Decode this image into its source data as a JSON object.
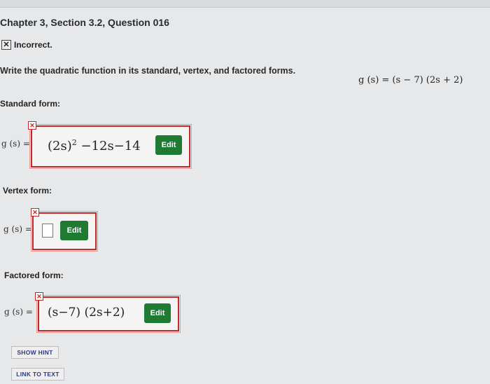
{
  "header": {
    "title": "Chapter 3, Section 3.2, Question 016"
  },
  "status": {
    "icon": "x-box-icon",
    "text": "Incorrect."
  },
  "question": {
    "text": "Write the quadratic function in its standard, vertex, and factored forms.",
    "given_function": "g (s) = (s − 7) (2s + 2)"
  },
  "standard": {
    "label": "Standard form:",
    "lhs": "g (s) =",
    "answer_base": "(2s)",
    "answer_exp": "2",
    "answer_rest": " −12s−14",
    "edit_label": "Edit",
    "marked_incorrect": true
  },
  "vertex": {
    "label": "Vertex form:",
    "lhs": "g (s) =",
    "answer": "",
    "edit_label": "Edit",
    "marked_incorrect": true
  },
  "factored": {
    "label": "Factored form:",
    "lhs": "g (s) =",
    "answer": "(s−7) (2s+2)",
    "edit_label": "Edit",
    "marked_incorrect": true
  },
  "buttons": {
    "show_hint": "SHOW HINT",
    "link_to_text": "LINK TO TEXT"
  },
  "colors": {
    "error_red": "#c62828",
    "edit_green": "#1f7a32",
    "link_blue": "#2a3b7a"
  }
}
